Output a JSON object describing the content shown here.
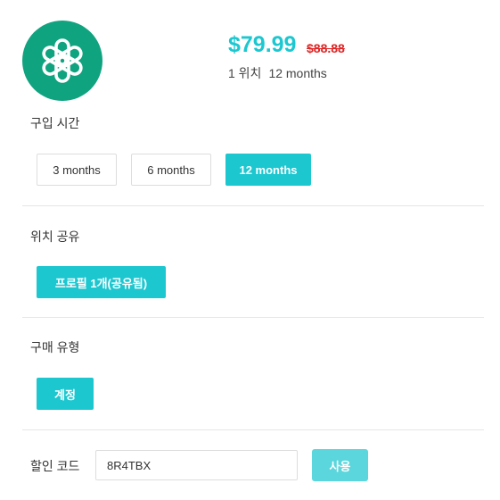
{
  "product": {
    "logo_icon": "openai-logo-icon",
    "price": "$79.99",
    "old_price": "$88.88",
    "meta_seats": "1 위치",
    "meta_duration": "12 months"
  },
  "duration": {
    "label": "구입 시간",
    "options": [
      "3 months",
      "6 months",
      "12 months"
    ],
    "selected": "12 months"
  },
  "sharing": {
    "label": "위치 공유",
    "options": [
      "프로필 1개(공유됨)"
    ],
    "selected": "프로필 1개(공유됨)"
  },
  "purchase_type": {
    "label": "구매 유형",
    "options": [
      "계정"
    ],
    "selected": "계정"
  },
  "coupon": {
    "label": "할인 코드",
    "value": "8R4TBX",
    "apply_label": "사용"
  },
  "colors": {
    "accent": "#1cc7d0",
    "old_price": "#e02424",
    "logo_bg": "#10a37f"
  }
}
